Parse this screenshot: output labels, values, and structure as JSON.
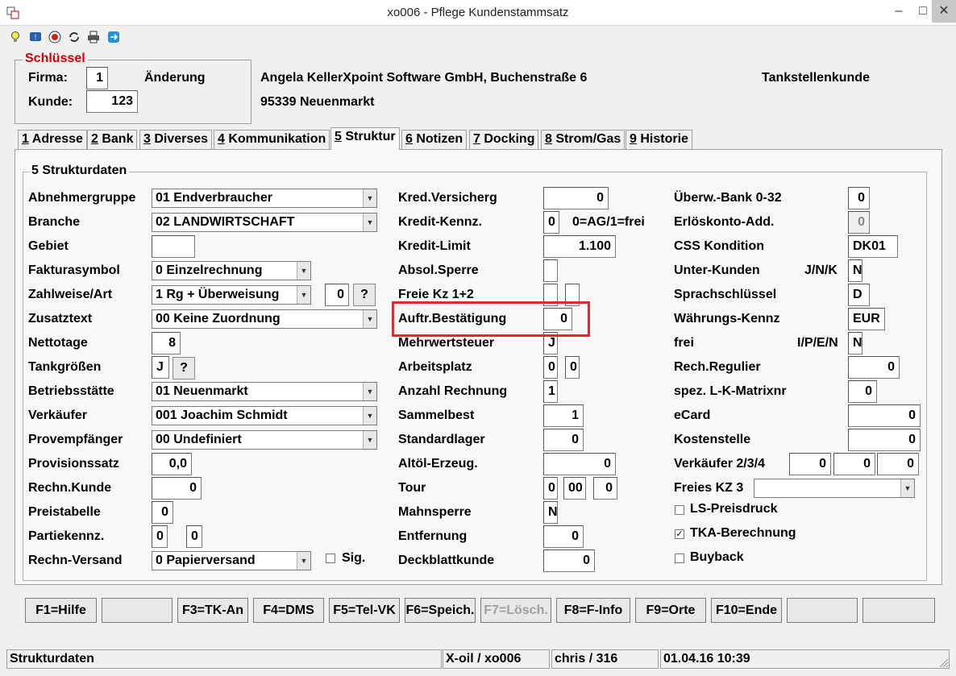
{
  "window": {
    "title": "xo006 - Pflege Kundenstammsatz",
    "buttons": [
      "–",
      "□",
      "✕"
    ]
  },
  "toolbar": {
    "icons": [
      "lightbulb-icon",
      "info-icon",
      "cancel-icon",
      "refresh-icon",
      "print-icon",
      "remote-icon"
    ]
  },
  "key": {
    "title": "Schlüssel",
    "firma_label": "Firma:",
    "firma_value": "1",
    "mode": "Änderung",
    "kunde_label": "Kunde:",
    "kunde_value": "123",
    "address_line1": "Angela KellerXpoint Software GmbH, Buchenstraße 6",
    "address_line2": "95339 Neuenmarkt",
    "customer_type": "Tankstellenkunde"
  },
  "tabs": [
    {
      "num": "1",
      "label": " Adresse"
    },
    {
      "num": "2",
      "label": " Bank"
    },
    {
      "num": "3",
      "label": " Diverses"
    },
    {
      "num": "4",
      "label": " Kommunikation"
    },
    {
      "num": "5",
      "label": " Struktur"
    },
    {
      "num": "6",
      "label": " Notizen"
    },
    {
      "num": "7",
      "label": " Docking"
    },
    {
      "num": "8",
      "label": " Strom/Gas"
    },
    {
      "num": "9",
      "label": " Historie"
    }
  ],
  "group_title": "5 Strukturdaten",
  "left": {
    "abnehmergruppe": {
      "label": "Abnehmergruppe",
      "value": "01 Endverbraucher"
    },
    "branche": {
      "label": "Branche",
      "value": "02 LANDWIRTSCHAFT"
    },
    "gebiet": {
      "label": "Gebiet",
      "value": ""
    },
    "fakturasymbol": {
      "label": "Fakturasymbol",
      "value": "0 Einzelrechnung"
    },
    "zahlweise": {
      "label": "Zahlweise/Art",
      "value": "1 Rg + Überweisung",
      "art": "0",
      "help": "?"
    },
    "zusatztext": {
      "label": "Zusatztext",
      "value": "00 Keine Zuordnung"
    },
    "nettotage": {
      "label": "Nettotage",
      "value": "8"
    },
    "tankgroessen": {
      "label": "Tankgrößen",
      "value": "J",
      "help": "?"
    },
    "betriebsstaette": {
      "label": "Betriebsstätte",
      "value": "01 Neuenmarkt"
    },
    "verkaeufer": {
      "label": "Verkäufer",
      "value": "001 Joachim Schmidt"
    },
    "provempfaenger": {
      "label": "Provempfänger",
      "value": "00 Undefiniert"
    },
    "provisionssatz": {
      "label": "Provisionssatz",
      "value": "0,0"
    },
    "rechn_kunde": {
      "label": "Rechn.Kunde",
      "value": "0"
    },
    "preistabelle": {
      "label": "Preistabelle",
      "value": "0"
    },
    "partiekennz": {
      "label": "Partiekennz.",
      "value1": "0",
      "value2": "0"
    },
    "rechn_versand": {
      "label": "Rechn-Versand",
      "value": "0 Papierversand",
      "sig_label": "Sig."
    }
  },
  "middle": {
    "kred_vers": {
      "label": "Kred.Versicherg",
      "value": "0"
    },
    "kredit_kennz": {
      "label": "Kredit-Kennz.",
      "value": "0",
      "hint": "0=AG/1=frei"
    },
    "kredit_limit": {
      "label": "Kredit-Limit",
      "value": "1.100"
    },
    "absol_sperre": {
      "label": "Absol.Sperre",
      "value": ""
    },
    "freie_kz": {
      "label": "Freie Kz 1+2",
      "value1": "",
      "value2": ""
    },
    "auftr_best": {
      "label": "Auftr.Bestätigung",
      "value": "0"
    },
    "mwst": {
      "label": "Mehrwertsteuer",
      "value": "J"
    },
    "arbeitsplatz": {
      "label": "Arbeitsplatz",
      "value1": "0",
      "value2": "0"
    },
    "anzahl_rechnung": {
      "label": "Anzahl Rechnung",
      "value": "1"
    },
    "sammelbest": {
      "label": "Sammelbest",
      "value": "1"
    },
    "standardlager": {
      "label": "Standardlager",
      "value": "0"
    },
    "altoel": {
      "label": "Altöl-Erzeug.",
      "value": "0"
    },
    "tour": {
      "label": "Tour",
      "value1": "0",
      "value2": "00",
      "value3": "0"
    },
    "mahnsperre": {
      "label": "Mahnsperre",
      "value": "N"
    },
    "entfernung": {
      "label": "Entfernung",
      "value": "0"
    },
    "deckblattkunde": {
      "label": "Deckblattkunde",
      "value": "0"
    }
  },
  "right": {
    "ueberw_bank": {
      "label": "Überw.-Bank 0-32",
      "value": "0"
    },
    "erloeskonto": {
      "label": "Erlöskonto-Add.",
      "value": "0"
    },
    "css_kondition": {
      "label": "CSS Kondition",
      "value": "DK01"
    },
    "unter_kunden": {
      "label": "Unter-Kunden",
      "hint": "J/N/K",
      "value": "N"
    },
    "sprachschluessel": {
      "label": "Sprachschlüssel",
      "value": "D"
    },
    "waehrung": {
      "label": "Währungs-Kennz",
      "value": "EUR"
    },
    "frei": {
      "label": "frei",
      "hint": "I/P/E/N",
      "value": "N"
    },
    "rech_regulier": {
      "label": "Rech.Regulier",
      "value": "0"
    },
    "lk_matrix": {
      "label": "spez. L-K-Matrixnr",
      "value": "0"
    },
    "ecard": {
      "label": "eCard",
      "value": "0"
    },
    "kostenstelle": {
      "label": "Kostenstelle",
      "value": "0"
    },
    "verkaeufer234": {
      "label": "Verkäufer 2/3/4",
      "value1": "0",
      "value2": "0",
      "value3": "0"
    },
    "freies_kz3": {
      "label": "Freies KZ 3",
      "value": ""
    },
    "ls_preisdruck": {
      "label": "LS-Preisdruck",
      "checked": false
    },
    "tka_berechnung": {
      "label": "TKA-Berechnung",
      "checked": true
    },
    "buyback": {
      "label": "Buyback",
      "checked": false
    }
  },
  "fkeys": [
    "F1=Hilfe",
    "",
    "F3=TK-An",
    "F4=DMS",
    "F5=Tel-VK",
    "F6=Speich.",
    "F7=Lösch.",
    "F8=F-Info",
    "F9=Orte",
    "F10=Ende",
    "",
    ""
  ],
  "status": {
    "text": "Strukturdaten",
    "system": "X-oil / xo006",
    "user": "chris / 316",
    "datetime": "01.04.16 10:39"
  }
}
